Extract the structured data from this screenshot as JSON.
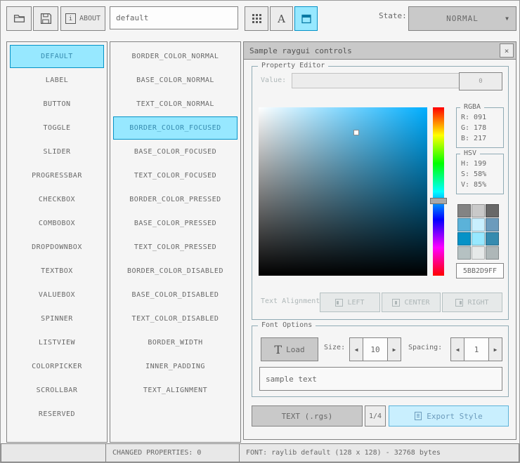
{
  "colors": {
    "bg": "#f5f5f5",
    "border_normal": "#838383",
    "base_normal": "#c9c9c9",
    "text_normal": "#686868",
    "border_focused": "#5bb2d9",
    "base_focused": "#c9effe",
    "text_focused": "#6c9bbc",
    "border_pressed": "#0492c7",
    "base_pressed": "#97e8ff",
    "text_pressed": "#368baf",
    "border_disabled": "#b5c1c2",
    "base_disabled": "#e6e9e9",
    "text_disabled": "#aeb7b8"
  },
  "icons": {
    "left_arrow": "◀",
    "right_arrow": "▶",
    "dropdown_arrow": "▼",
    "close": "×",
    "info": "i",
    "font_letter": "A",
    "load_glyph": "T"
  },
  "toolbar": {
    "about_label": "ABOUT",
    "style_name_value": "default",
    "state_label": "State:",
    "state_value": "NORMAL"
  },
  "controls_list": {
    "items": [
      "DEFAULT",
      "LABEL",
      "BUTTON",
      "TOGGLE",
      "SLIDER",
      "PROGRESSBAR",
      "CHECKBOX",
      "COMBOBOX",
      "DROPDOWNBOX",
      "TEXTBOX",
      "VALUEBOX",
      "SPINNER",
      "LISTVIEW",
      "COLORPICKER",
      "SCROLLBAR",
      "RESERVED"
    ],
    "selected": "DEFAULT"
  },
  "properties_list": {
    "items": [
      "BORDER_COLOR_NORMAL",
      "BASE_COLOR_NORMAL",
      "TEXT_COLOR_NORMAL",
      "BORDER_COLOR_FOCUSED",
      "BASE_COLOR_FOCUSED",
      "TEXT_COLOR_FOCUSED",
      "BORDER_COLOR_PRESSED",
      "BASE_COLOR_PRESSED",
      "TEXT_COLOR_PRESSED",
      "BORDER_COLOR_DISABLED",
      "BASE_COLOR_DISABLED",
      "TEXT_COLOR_DISABLED",
      "BORDER_WIDTH",
      "INNER_PADDING",
      "TEXT_ALIGNMENT"
    ],
    "selected": "BORDER_COLOR_FOCUSED"
  },
  "sample_window": {
    "title": "Sample raygui controls",
    "property_editor": {
      "group_label": "Property Editor",
      "value_label": "Value:",
      "value_text": "",
      "value_button": "0",
      "rgba": {
        "title": "RGBA",
        "r": "R: 091",
        "g": "G: 178",
        "b": "B: 217"
      },
      "hsv": {
        "title": "HSV",
        "h": "H: 199",
        "s": "S: 58%",
        "v": "V: 85%"
      },
      "hex_value": "5BB2D9FF",
      "palette": [
        "#838383",
        "#c9c9c9",
        "#686868",
        "#5bb2d9",
        "#c9effe",
        "#6c9bbc",
        "#0492c7",
        "#97e8ff",
        "#368baf",
        "#b5c1c2",
        "#e6e9e9",
        "#aeb7b8"
      ],
      "text_alignment_label": "Text Alignment:",
      "alignment_buttons": [
        "LEFT",
        "CENTER",
        "RIGHT"
      ]
    },
    "font_options": {
      "group_label": "Font Options",
      "load_button": "Load",
      "size_label": "Size:",
      "size_value": "10",
      "spacing_label": "Spacing:",
      "spacing_value": "1",
      "sample_text": "sample text"
    },
    "export": {
      "format_button": "TEXT (.rgs)",
      "page_indicator": "1/4",
      "export_button": "Export Style"
    }
  },
  "status_bar": {
    "changed_properties": "CHANGED PROPERTIES: 0",
    "font_info": "FONT: raylib default (128 x 128) - 32768 bytes"
  },
  "color_picker": {
    "hue_deg": 199,
    "sat_pct": 58,
    "val_pct": 85
  }
}
